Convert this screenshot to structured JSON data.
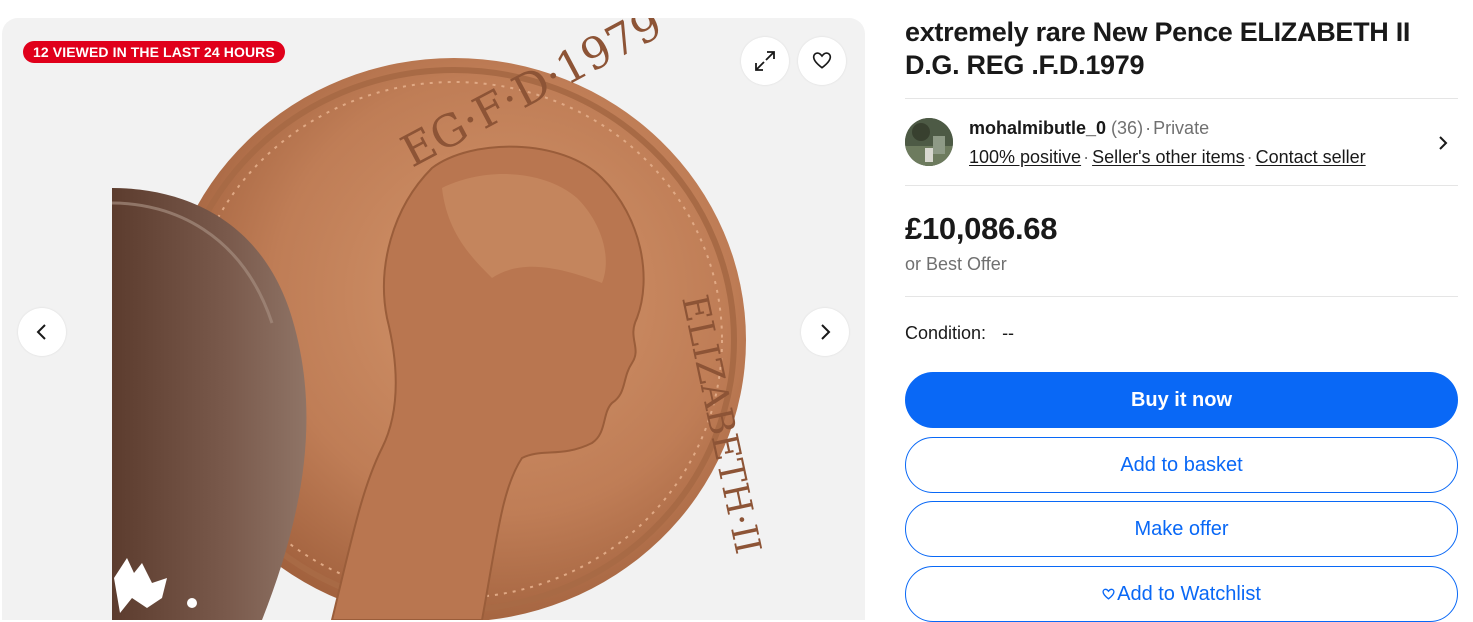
{
  "gallery": {
    "badge": "12 VIEWED IN THE LAST 24 HOURS",
    "coin_legend_top": "EG·F·D·1979",
    "coin_legend_right": "ELIZABETH·II",
    "icons": {
      "expand": "expand-icon",
      "watch": "heart-icon",
      "prev": "chevron-left-icon",
      "next": "chevron-right-icon"
    }
  },
  "listing": {
    "title": "extremely rare New Pence ELIZABETH II D.G. REG .F.D.1979"
  },
  "seller": {
    "name": "mohalmibutle_0",
    "feedback_count": "(36)",
    "type": "Private",
    "separator": "·",
    "positive": "100% positive",
    "other_items": "Seller's other items",
    "contact": "Contact seller"
  },
  "price": {
    "amount": "£10,086.68",
    "best_offer": "or Best Offer"
  },
  "condition": {
    "label": "Condition:",
    "value": "--"
  },
  "actions": {
    "buy": "Buy it now",
    "basket": "Add to basket",
    "offer": "Make offer",
    "watch": "Add to Watchlist"
  },
  "colors": {
    "accent_blue": "#0968f6",
    "badge_red": "#e0001b",
    "coin_copper": "#c0805a"
  }
}
